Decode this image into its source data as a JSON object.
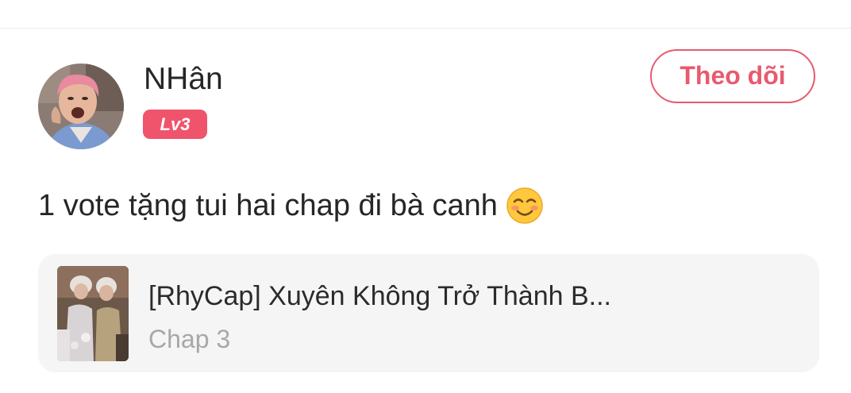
{
  "user": {
    "name": "NHân",
    "level": "Lv3",
    "avatar": "user-avatar-photo"
  },
  "follow_button": {
    "label": "Theo dõi"
  },
  "comment": {
    "text": "1 vote tặng tui hai chap đi bà canh",
    "emoji": "smiling-blushing-face-emoji"
  },
  "chapter_card": {
    "title": "[RhyCap] Xuyên Không Trở Thành B...",
    "chapter": "Chap 3",
    "thumbnail": "manga-cover-thumbnail"
  },
  "colors": {
    "accent": "#e85a6e",
    "badge": "#f0546c",
    "card_bg": "#f5f5f5",
    "text": "#262626",
    "muted": "#a8a8a8"
  }
}
